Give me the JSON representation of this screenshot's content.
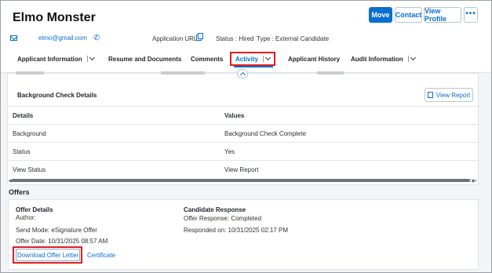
{
  "header": {
    "candidate_name": "Elmo Monster",
    "buttons": {
      "move": "Move",
      "contact": "Contact",
      "view_profile": "View Profile",
      "more": "•••"
    },
    "email": "elmo@gmail.com",
    "application_url_label": "Application URL",
    "status": "Status : Hired",
    "type": "Type : External Candidate"
  },
  "tabs": [
    {
      "label": "Applicant Information",
      "has_menu": true
    },
    {
      "label": "Resume and Documents",
      "has_menu": false
    },
    {
      "label": "Comments",
      "has_menu": false
    },
    {
      "label": "Activity",
      "has_menu": true,
      "active": true
    },
    {
      "label": "Applicant History",
      "has_menu": false
    },
    {
      "label": "Audit Information",
      "has_menu": true
    }
  ],
  "background_check": {
    "title": "Background Check Details",
    "view_report_button": "View Report",
    "columns": [
      "Details",
      "Values"
    ],
    "rows": [
      [
        "Background",
        "Background Check Complete"
      ],
      [
        "Status",
        "Yes"
      ],
      [
        "View Status",
        "View Report"
      ]
    ]
  },
  "offers": {
    "section_title": "Offers",
    "offer_details": {
      "heading": "Offer Details",
      "author": "Author:",
      "send_mode": "Send Mode: eSignature Offer",
      "offer_date": "Offer Date: 10/31/2025 08:57 AM"
    },
    "candidate_response": {
      "heading": "Candidate Response",
      "offer_response": "Offer Response: Completed",
      "responded_on": "Responded on: 10/31/2025 02:17 PM"
    },
    "download_button": "Download Offer Letter",
    "certificate_link": "Certificate"
  },
  "colors": {
    "accent": "#0a6ed1",
    "highlight": "#e01e1e"
  }
}
